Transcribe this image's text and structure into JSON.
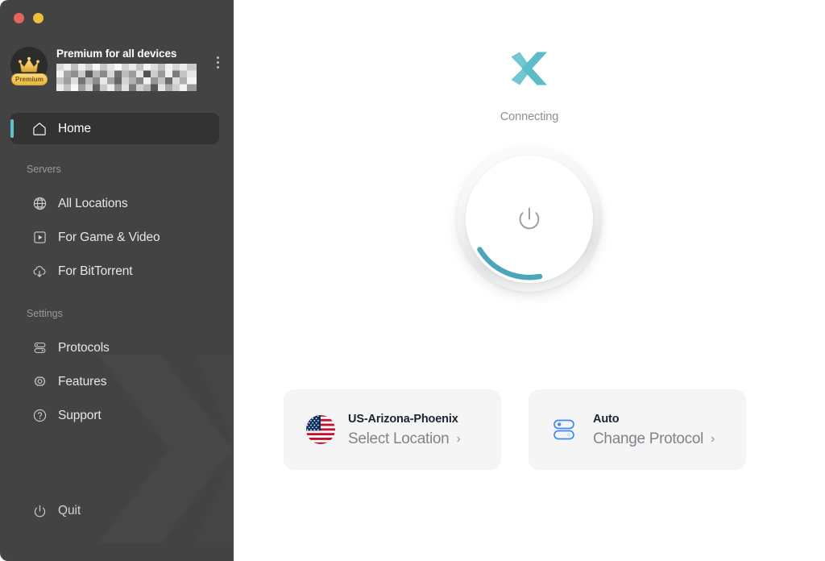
{
  "window": {
    "traffic_lights": [
      {
        "name": "close",
        "color": "#e8635c"
      },
      {
        "name": "minimize",
        "color": "#f1bd3c"
      }
    ]
  },
  "sidebar": {
    "account": {
      "badge_label": "Premium",
      "title": "Premium for all devices",
      "email_redacted": true,
      "menu_icon": "kebab-menu-icon"
    },
    "nav": [
      {
        "id": "home",
        "label": "Home",
        "icon": "home-icon",
        "active": true
      },
      {
        "id": "servers-section",
        "label": "Servers",
        "type": "section"
      },
      {
        "id": "all-locations",
        "label": "All Locations",
        "icon": "globe-icon",
        "active": false
      },
      {
        "id": "for-game-video",
        "label": "For Game & Video",
        "icon": "play-square-icon",
        "active": false
      },
      {
        "id": "for-bittorrent",
        "label": "For BitTorrent",
        "icon": "cloud-download-icon",
        "active": false
      },
      {
        "id": "settings-section",
        "label": "Settings",
        "type": "section"
      },
      {
        "id": "protocols",
        "label": "Protocols",
        "icon": "sliders-icon",
        "active": false
      },
      {
        "id": "features",
        "label": "Features",
        "icon": "gear-icon",
        "active": false
      },
      {
        "id": "support",
        "label": "Support",
        "icon": "question-circle-icon",
        "active": false
      }
    ],
    "quit": {
      "label": "Quit",
      "icon": "power-icon"
    },
    "colors": {
      "background": "#434343",
      "active_item": "#333333",
      "accent_indicator": "#5cc2ce"
    }
  },
  "main": {
    "logo": "x-vpn-logo-icon",
    "status": "Connecting",
    "power_button": {
      "icon": "power-icon",
      "progress_arc_color": "#4ba6bb",
      "state": "connecting"
    },
    "cards": [
      {
        "id": "location",
        "icon": "us-flag-icon",
        "title": "US-Arizona-Phoenix",
        "action_label": "Select Location",
        "chevron": "›"
      },
      {
        "id": "protocol",
        "icon": "protocol-sliders-icon",
        "title": "Auto",
        "action_label": "Change Protocol",
        "chevron": "›"
      }
    ],
    "colors": {
      "background": "#ffffff",
      "card_background": "#f5f5f6",
      "accent": "#5cc2ce",
      "status_text": "#8b8f96"
    }
  }
}
